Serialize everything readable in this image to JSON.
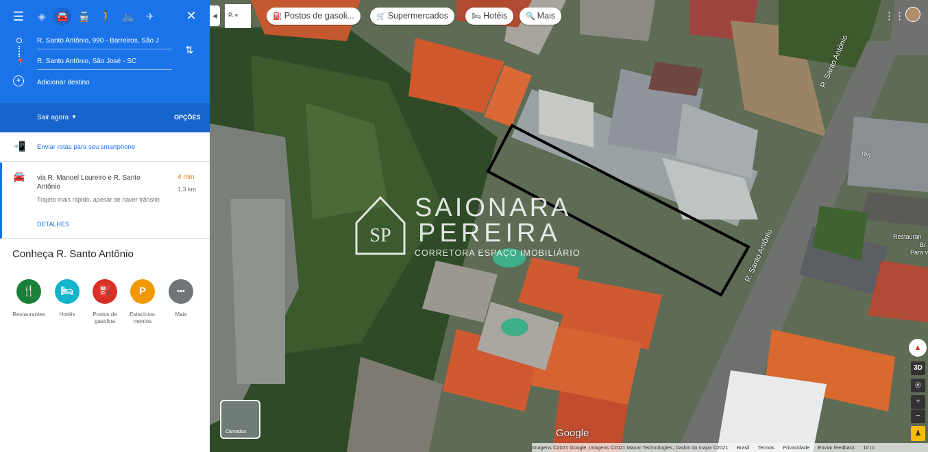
{
  "directions": {
    "modes": [
      "best",
      "car",
      "transit",
      "walk",
      "bike",
      "flight"
    ],
    "origin": "R. Santo Antônio, 990 - Barreiros, São J",
    "destination": "R. Santo Antônio, São José - SC",
    "add_destination": "Adicionar destino",
    "depart_label": "Sair agora",
    "options_label": "OPÇÕES",
    "send_to_phone": "Enviar rotas para seu smartphone"
  },
  "route": {
    "via": "via R. Manoel Loureiro e R. Santo Antônio",
    "time": "4 min",
    "distance": "1,3 km",
    "note": "Trajeto mais rápido, apesar de haver trânsito",
    "details": "DETALHES"
  },
  "explore": {
    "title": "Conheça R. Santo Antônio",
    "categories": [
      {
        "label": "Restaurantes",
        "icon": "fork-knife-icon",
        "color": "#188038",
        "glyph": "🍴"
      },
      {
        "label": "Hotéis",
        "icon": "bed-icon",
        "color": "#12b5cb",
        "glyph": "🛏"
      },
      {
        "label": "Postos de gasolina",
        "icon": "gas-pump-icon",
        "color": "#d93025",
        "glyph": "⛽"
      },
      {
        "label": "Estaciona-mentos",
        "icon": "parking-icon",
        "color": "#f29900",
        "glyph": "P"
      },
      {
        "label": "Mais",
        "icon": "more-icon",
        "color": "#70757a",
        "glyph": "•••"
      }
    ]
  },
  "map": {
    "mini_select": "P̶",
    "chips": [
      {
        "label": "Postos de gasoli...",
        "icon": "gas-pump-icon"
      },
      {
        "label": "Supermercados",
        "icon": "cart-icon"
      },
      {
        "label": "Hotéis",
        "icon": "bed-icon"
      },
      {
        "label": "Mais",
        "icon": "search-icon"
      }
    ],
    "streets": [
      "R. Santo Antônio",
      "R. Santo Antônio"
    ],
    "pois": [
      "Rvj",
      "Restauran",
      "Br",
      "Para v"
    ],
    "watermark": {
      "line1": "SAIONARA",
      "line2": "PEREIRA",
      "line3": "CORRETORA ESPAÇO IMOBILIÁRIO",
      "monogram": "SP"
    },
    "layers_label": "Camadas",
    "btn_3d": "3D",
    "google": "Google",
    "footer": {
      "imagery": "Imagens ©2021 Google, Imagens ©2021 Maxar Technologies, Dados do mapa ©2021",
      "country": "Brasil",
      "terms": "Termos",
      "privacy": "Privacidade",
      "feedback": "Enviar feedback",
      "scale": "10 m"
    },
    "colors": {
      "accent": "#1a73e8",
      "parcel_outline": "#000000"
    }
  }
}
